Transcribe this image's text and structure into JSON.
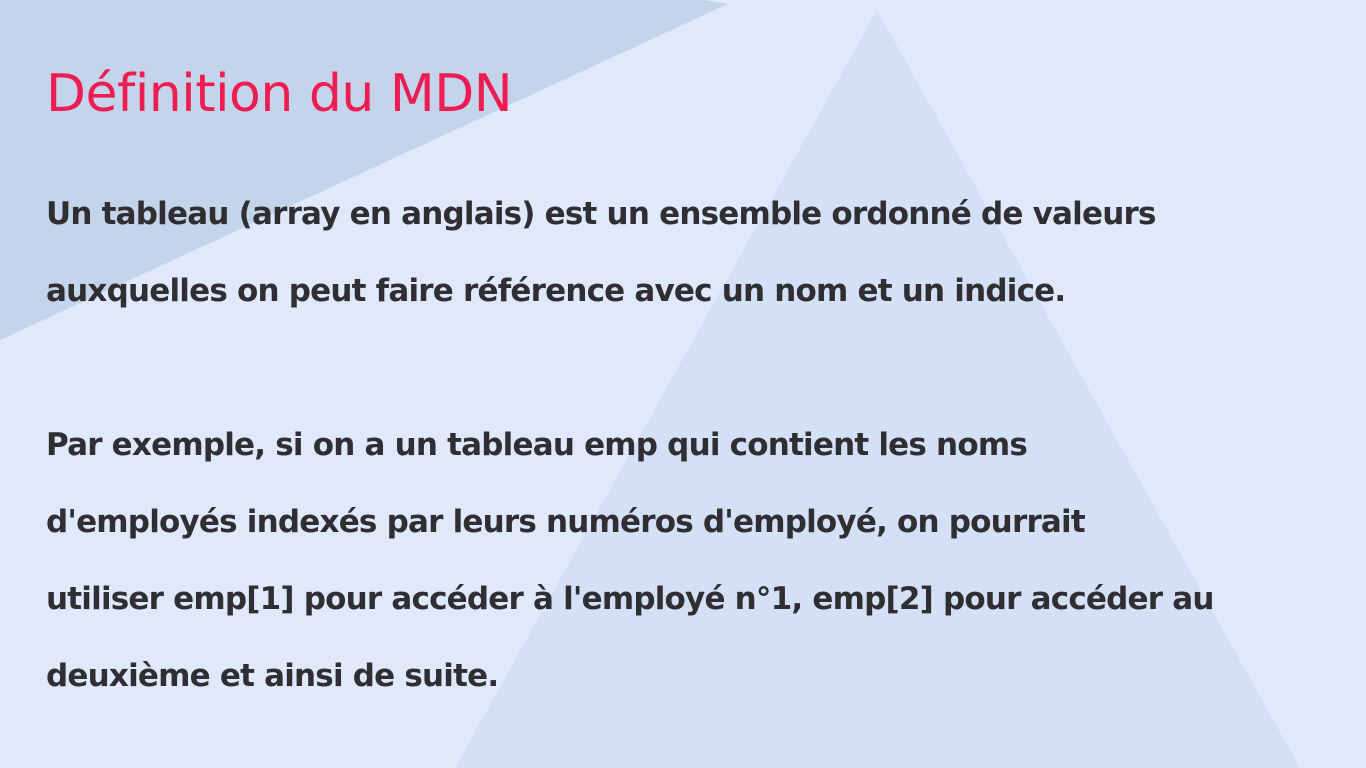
{
  "colors": {
    "background": "#dfe9fb",
    "stripe": "#c4d4ea",
    "triangle": "#d4e0f6",
    "title": "#ef1b53",
    "body_text": "#2f2f33"
  },
  "slide": {
    "title": "Définition du MDN",
    "paragraphs": [
      {
        "lines": [
          "Un tableau (array en anglais) est un ensemble ordonné de valeurs",
          "auxquelles on peut faire référence avec un nom et un indice."
        ]
      },
      {
        "lines": [
          "Par exemple, si on a un tableau emp qui contient les noms",
          "d'employés indexés par leurs numéros d'employé, on pourrait",
          "utiliser emp[1] pour accéder à l'employé n°1, emp[2] pour accéder au",
          "deuxième et ainsi de suite."
        ]
      }
    ]
  }
}
